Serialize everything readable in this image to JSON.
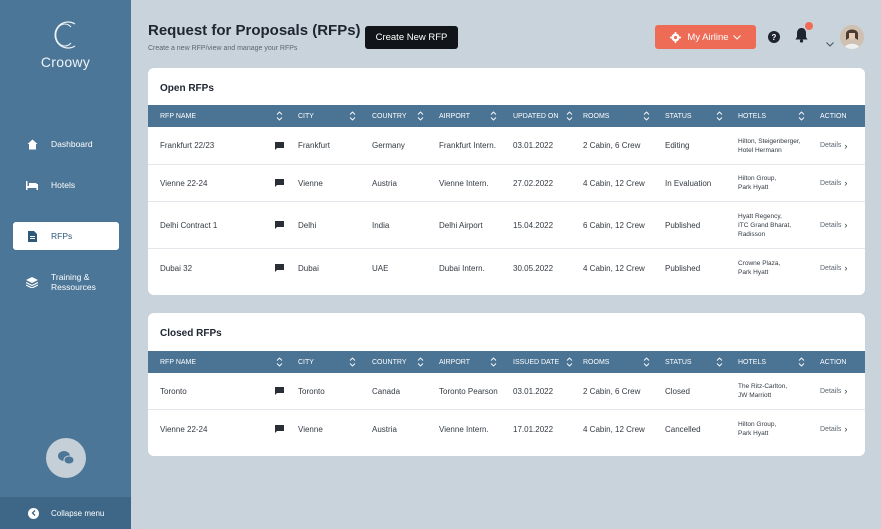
{
  "brand": {
    "name": "Croowy"
  },
  "nav": [
    {
      "label": "Dashboard",
      "icon": "home-icon"
    },
    {
      "label": "Hotels",
      "icon": "bed-icon"
    },
    {
      "label": "RFPs",
      "icon": "document-icon",
      "active": true
    },
    {
      "label": "Training &",
      "label2": "Ressources",
      "icon": "layers-icon"
    }
  ],
  "collapse_label": "Collapse menu",
  "header": {
    "title": "Request for Proposals (RFPs)",
    "subtitle": "Create a new RFP/view and manage your RFPs",
    "create_button": "Create New RFP",
    "airline_button": "My Airline"
  },
  "open": {
    "title": "Open RFPs",
    "columns": [
      "RFP NAME",
      "CITY",
      "COUNTRY",
      "AIRPORT",
      "UPDATED ON",
      "ROOMS",
      "STATUS",
      "HOTELS",
      "ACTION"
    ],
    "rows": [
      {
        "name": "Frankfurt 22/23",
        "city": "Frankfurt",
        "country": "Germany",
        "airport": "Frankfurt Intern.",
        "date": "03.01.2022",
        "rooms": "2 Cabin, 6 Crew",
        "status": "Editing",
        "hotels": [
          "Hilton, Steigenberger,",
          "Hotel Hermann"
        ],
        "action": "Details"
      },
      {
        "name": "Vienne 22-24",
        "city": "Vienne",
        "country": "Austria",
        "airport": "Vienne Intern.",
        "date": "27.02.2022",
        "rooms": "4 Cabin, 12 Crew",
        "status": "In Evaluation",
        "hotels": [
          "Hilton Group,",
          "Park Hyatt"
        ],
        "action": "Details"
      },
      {
        "name": "Delhi Contract 1",
        "city": "Delhi",
        "country": "India",
        "airport": "Delhi Airport",
        "date": "15.04.2022",
        "rooms": "6 Cabin, 12 Crew",
        "status": "Published",
        "hotels": [
          "Hyatt Regency,",
          "ITC Grand Bharat,",
          "Radisson"
        ],
        "action": "Details"
      },
      {
        "name": "Dubai 32",
        "city": "Dubai",
        "country": "UAE",
        "airport": "Dubai Intern.",
        "date": "30.05.2022",
        "rooms": "4 Cabin, 12 Crew",
        "status": "Published",
        "hotels": [
          "Crowne Plaza,",
          "Park Hyatt"
        ],
        "action": "Details"
      }
    ]
  },
  "closed": {
    "title": "Closed RFPs",
    "columns": [
      "RFP NAME",
      "CITY",
      "COUNTRY",
      "AIRPORT",
      "ISSUED DATE",
      "ROOMS",
      "STATUS",
      "HOTELS",
      "ACTION"
    ],
    "rows": [
      {
        "name": "Toronto",
        "city": "Toronto",
        "country": "Canada",
        "airport": "Toronto Pearson",
        "date": "03.01.2022",
        "rooms": "2 Cabin, 6 Crew",
        "status": "Closed",
        "hotels": [
          "The Ritz-Carlton,",
          "JW Marriott"
        ],
        "action": "Details"
      },
      {
        "name": "Vienne 22-24",
        "city": "Vienne",
        "country": "Austria",
        "airport": "Vienne Intern.",
        "date": "17.01.2022",
        "rooms": "4 Cabin, 12 Crew",
        "status": "Cancelled",
        "hotels": [
          "Hilton Group,",
          "Park Hyatt"
        ],
        "action": "Details"
      }
    ]
  },
  "colors": {
    "sidebar": "#4c7697",
    "accent": "#ee6b55",
    "header_row": "#4a7394"
  }
}
